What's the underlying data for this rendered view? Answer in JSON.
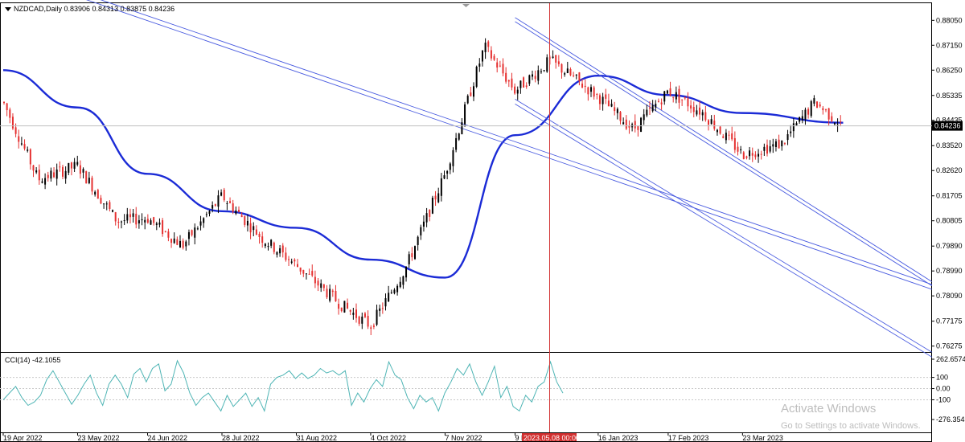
{
  "header": {
    "symbol_line": "NZDCAD,Daily  0.83906 0.84313 0.83875 0.84236"
  },
  "price_axis": {
    "ticks": [
      "0.88050",
      "0.87150",
      "0.86250",
      "0.85335",
      "0.84435",
      "0.83520",
      "0.82620",
      "0.81705",
      "0.80805",
      "0.79890",
      "0.78990",
      "0.78090",
      "0.77175",
      "0.76275"
    ],
    "tick_values": [
      0.8805,
      0.8715,
      0.8625,
      0.85335,
      0.84435,
      0.8352,
      0.8262,
      0.81705,
      0.80805,
      0.7989,
      0.7899,
      0.7809,
      0.77175,
      0.76275
    ],
    "current_price": "0.84236",
    "current_value": 0.84236,
    "ymin": 0.7609,
    "ymax": 0.8864
  },
  "time_axis": {
    "labels": [
      "19 Apr 2022",
      "23 May 2022",
      "24 Jun 2022",
      "28 Jul 2022",
      "31 Aug 2022",
      "4 Oct 2022",
      "7 Nov 2022",
      "9 Dec 2022",
      "16 Jan 2023",
      "17 Feb 2023",
      "23 Mar 2023"
    ],
    "cursor_label": "2023.05.08 00:00"
  },
  "indicator": {
    "title": "CCI(14) -42.1055",
    "levels": [
      "262.6574",
      "100",
      "0.00",
      "-100",
      "-276.3546"
    ],
    "level_values": [
      262.6574,
      100,
      0,
      -100,
      -276.3546
    ]
  },
  "colors": {
    "bull": "#000000",
    "bear": "#e53030",
    "ma": "#1b2bd6",
    "channel": "#4a5ce0",
    "cci": "#4fb5b5",
    "cursor": "#d23030",
    "grid": "#c8c8c8"
  },
  "chart_data": [
    {
      "type": "candlestick",
      "title": "NZDCAD,Daily",
      "ylim": [
        0.7609,
        0.8864
      ],
      "x_range": [
        "19 Apr 2022",
        "2023.05.08"
      ],
      "ohlc_last": {
        "open": 0.83906,
        "high": 0.84313,
        "low": 0.83875,
        "close": 0.84236
      },
      "price_path": [
        {
          "date": "19 Apr 2022",
          "close": 0.851
        },
        {
          "date": "5 May 2022",
          "close": 0.823
        },
        {
          "date": "23 May 2022",
          "close": 0.828
        },
        {
          "date": "10 Jun 2022",
          "close": 0.808
        },
        {
          "date": "24 Jun 2022",
          "close": 0.809
        },
        {
          "date": "10 Jul 2022",
          "close": 0.799
        },
        {
          "date": "28 Jul 2022",
          "close": 0.817
        },
        {
          "date": "15 Aug 2022",
          "close": 0.802
        },
        {
          "date": "31 Aug 2022",
          "close": 0.792
        },
        {
          "date": "20 Sep 2022",
          "close": 0.778
        },
        {
          "date": "4 Oct 2022",
          "close": 0.77
        },
        {
          "date": "20 Oct 2022",
          "close": 0.791
        },
        {
          "date": "7 Nov 2022",
          "close": 0.825
        },
        {
          "date": "25 Nov 2022",
          "close": 0.871
        },
        {
          "date": "9 Dec 2022",
          "close": 0.855
        },
        {
          "date": "25 Dec 2022",
          "close": 0.866
        },
        {
          "date": "16 Jan 2023",
          "close": 0.853
        },
        {
          "date": "1 Feb 2023",
          "close": 0.841
        },
        {
          "date": "17 Feb 2023",
          "close": 0.855
        },
        {
          "date": "5 Mar 2023",
          "close": 0.847
        },
        {
          "date": "23 Mar 2023",
          "close": 0.832
        },
        {
          "date": "10 Apr 2023",
          "close": 0.836
        },
        {
          "date": "25 Apr 2023",
          "close": 0.851
        },
        {
          "date": "8 May 2023",
          "close": 0.842
        }
      ],
      "moving_average": [
        {
          "date": "19 Apr 2022",
          "value": 0.8625
        },
        {
          "date": "23 May 2022",
          "value": 0.849
        },
        {
          "date": "24 Jun 2022",
          "value": 0.825
        },
        {
          "date": "28 Jul 2022",
          "value": 0.8115
        },
        {
          "date": "31 Aug 2022",
          "value": 0.8055
        },
        {
          "date": "4 Oct 2022",
          "value": 0.794
        },
        {
          "date": "7 Nov 2022",
          "value": 0.7875
        },
        {
          "date": "9 Dec 2022",
          "value": 0.839
        },
        {
          "date": "16 Jan 2023",
          "value": 0.8605
        },
        {
          "date": "17 Feb 2023",
          "value": 0.8535
        },
        {
          "date": "23 Mar 2023",
          "value": 0.847
        },
        {
          "date": "8 May 2023",
          "value": 0.8435
        }
      ],
      "channel_lines": [
        {
          "from": {
            "date": "19 Apr 2022",
            "value": 0.9
          },
          "to": {
            "date": "end",
            "value": 0.785
          }
        },
        {
          "from": {
            "date": "9 Dec 2022",
            "value": 0.8815
          },
          "to": {
            "date": "end",
            "value": 0.786
          }
        },
        {
          "from": {
            "date": "9 Dec 2022",
            "value": 0.852
          },
          "to": {
            "date": "end",
            "value": 0.7605
          }
        }
      ]
    },
    {
      "type": "line",
      "title": "CCI(14)",
      "last_value": -42.1055,
      "ylim": [
        -276.3546,
        262.6574
      ],
      "values": [
        -100,
        -40,
        20,
        -80,
        -150,
        -120,
        -60,
        80,
        160,
        60,
        -40,
        -140,
        -60,
        40,
        120,
        -40,
        -150,
        40,
        120,
        40,
        -80,
        130,
        180,
        60,
        180,
        220,
        -20,
        40,
        250,
        140,
        -40,
        -150,
        -80,
        -40,
        -120,
        -200,
        -60,
        -160,
        -100,
        -40,
        -160,
        -80,
        -200,
        40,
        100,
        120,
        160,
        90,
        140,
        90,
        120,
        180,
        140,
        160,
        120,
        160,
        -150,
        -40,
        -120,
        0,
        80,
        20,
        240,
        120,
        80,
        -80,
        -180,
        -60,
        -120,
        -80,
        -200,
        -40,
        60,
        180,
        120,
        220,
        60,
        -60,
        60,
        200,
        -80,
        20,
        -160,
        -200,
        -60,
        -120,
        20,
        60,
        240,
        60,
        -40
      ]
    }
  ]
}
